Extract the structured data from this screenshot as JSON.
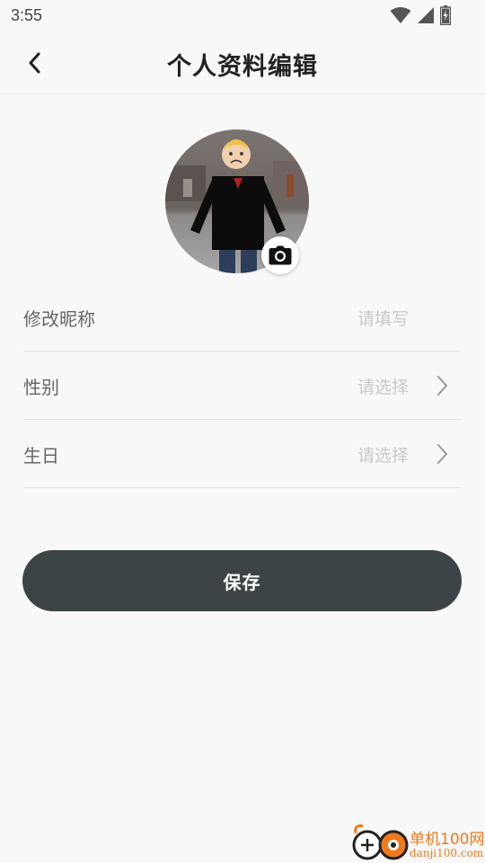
{
  "status_bar": {
    "time": "3:55",
    "icons": [
      "wifi-icon",
      "signal-icon",
      "battery-icon"
    ]
  },
  "header": {
    "back_icon": "chevron-left-icon",
    "title": "个人资料编辑"
  },
  "avatar": {
    "camera_icon": "camera-icon"
  },
  "form": {
    "nickname": {
      "label": "修改昵称",
      "placeholder": "请填写"
    },
    "gender": {
      "label": "性别",
      "placeholder": "请选择",
      "icon": "chevron-right-icon"
    },
    "birthday": {
      "label": "生日",
      "placeholder": "请选择",
      "icon": "chevron-right-icon"
    }
  },
  "actions": {
    "save_label": "保存"
  },
  "colors": {
    "background": "#f8f8f8",
    "primary_button": "#3c4446",
    "placeholder": "#c8c8c8",
    "watermark": "#f07a1a"
  },
  "watermark": {
    "title": "单机100网",
    "url": "danji100.com"
  }
}
